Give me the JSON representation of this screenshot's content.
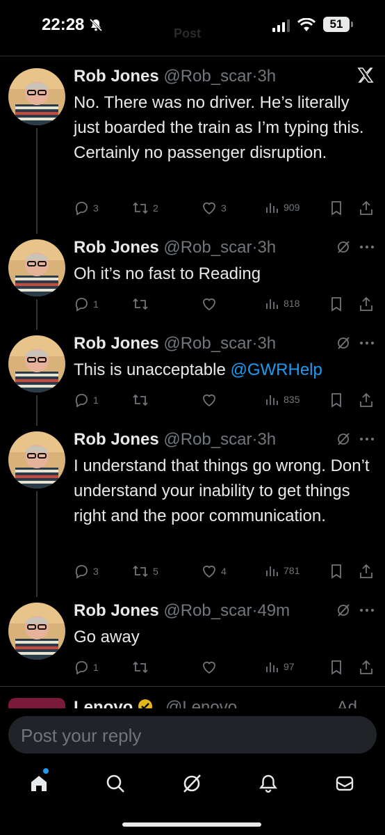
{
  "status_bar": {
    "time": "22:28",
    "faded_title": "Post",
    "battery": "51"
  },
  "colors": {
    "accent": "#1d9bf0",
    "text": "#e7e9ea",
    "muted": "#71767b",
    "background": "#000000"
  },
  "tweets": [
    {
      "name": "Rob Jones",
      "handle": "@Rob_scar",
      "sep": "·",
      "time": "3h",
      "text": "No. There was no driver. He’s literally just boarded the train as I’m typing this. Certainly no passenger disruption.",
      "replies": "3",
      "reposts": "2",
      "likes": "3",
      "views": "909",
      "corner_icon": "x-logo-icon"
    },
    {
      "name": "Rob Jones",
      "handle": "@Rob_scar",
      "sep": "·",
      "time": "3h",
      "text": "Oh it’s no fast to Reading",
      "replies": "1",
      "reposts": "",
      "likes": "",
      "views": "818",
      "corner_icon": "grok-icon"
    },
    {
      "name": "Rob Jones",
      "handle": "@Rob_scar",
      "sep": "·",
      "time": "3h",
      "text_before": "This is unacceptable ",
      "mention": "@GWRHelp",
      "replies": "1",
      "reposts": "",
      "likes": "",
      "views": "835",
      "corner_icon": "grok-icon"
    },
    {
      "name": "Rob Jones",
      "handle": "@Rob_scar",
      "sep": "·",
      "time": "3h",
      "text": "I understand that things go wrong. Don’t understand your inability to get things right and the poor communication.",
      "replies": "3",
      "reposts": "5",
      "likes": "4",
      "views": "781",
      "corner_icon": "grok-icon"
    },
    {
      "name": "Rob Jones",
      "handle": "@Rob_scar",
      "sep": "·",
      "time": "49m",
      "text": "Go away",
      "replies": "1",
      "reposts": "",
      "likes": "",
      "views": "97",
      "corner_icon": "grok-icon"
    }
  ],
  "ad": {
    "name": "Lenovo",
    "handle": "@Lenovo",
    "tag": "Ad"
  },
  "reply": {
    "placeholder": "Post your reply"
  },
  "nav": [
    "home-icon",
    "search-icon",
    "grok-icon",
    "notifications-icon",
    "messages-icon"
  ]
}
